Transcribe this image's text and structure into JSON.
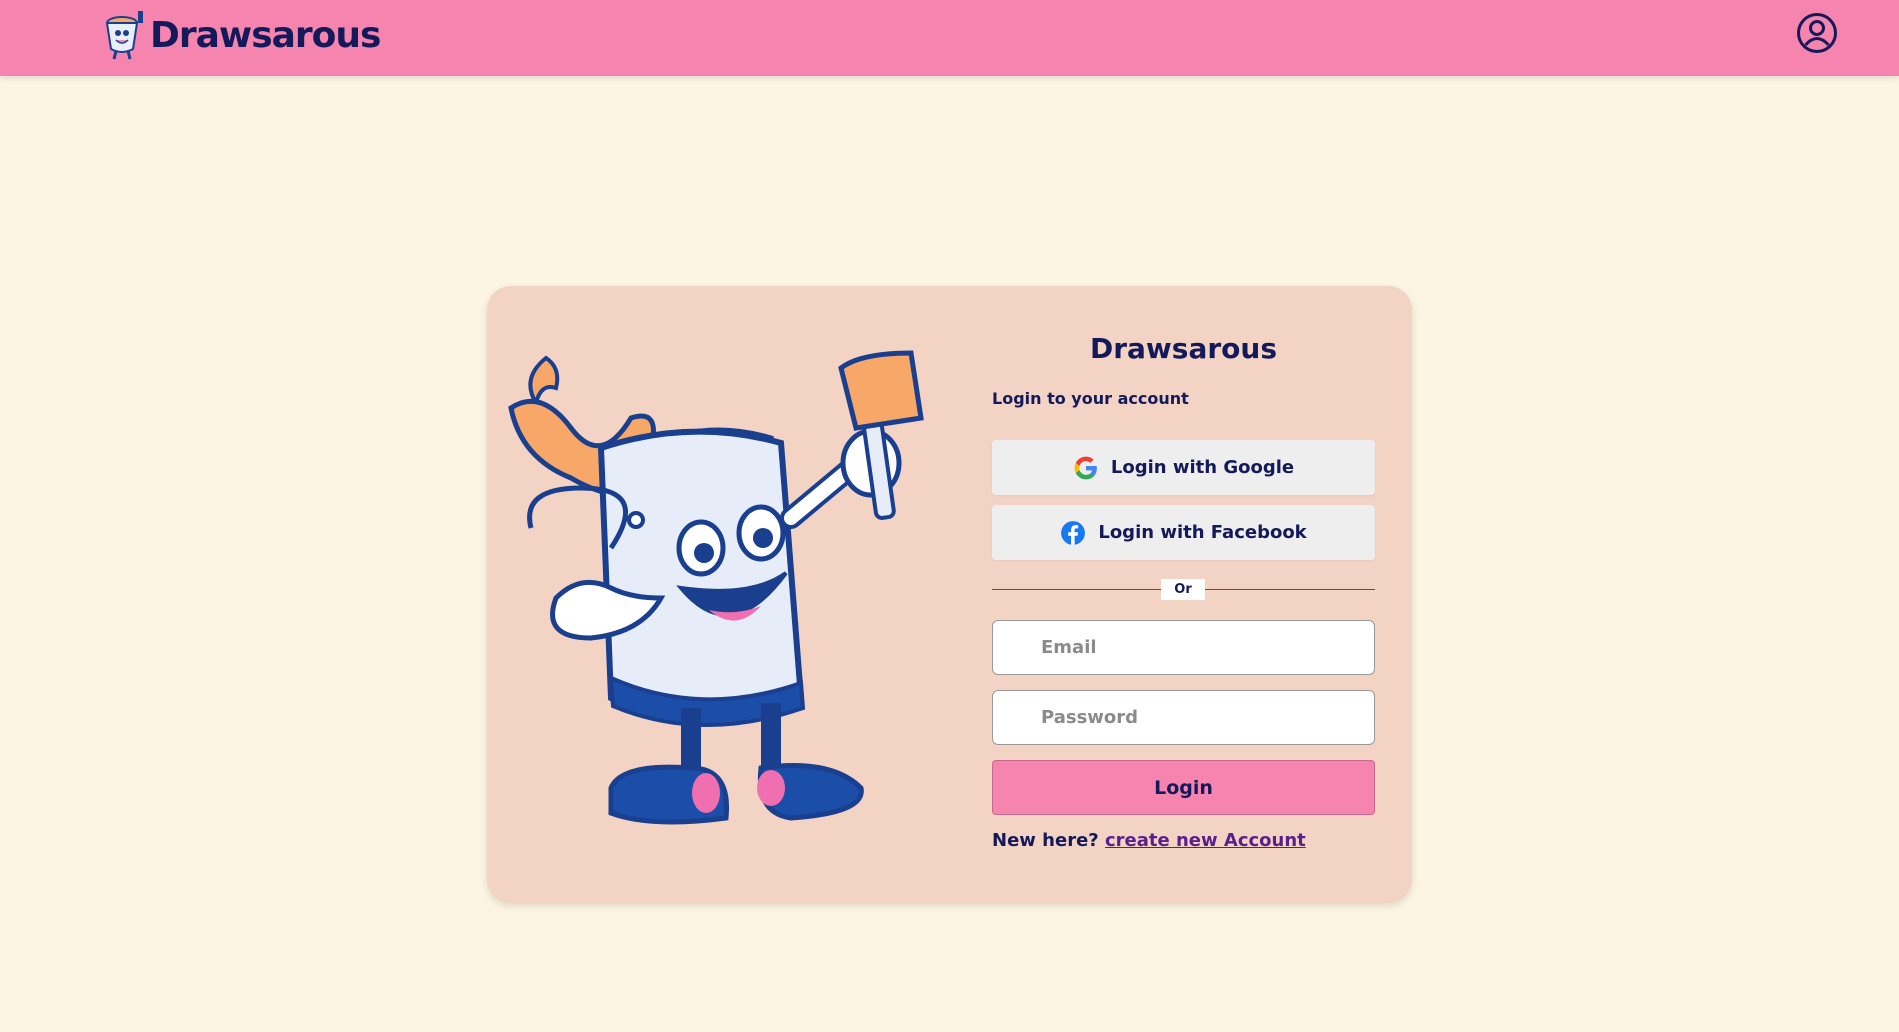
{
  "header": {
    "brand_name": "Drawsarous",
    "account_icon": "user-circle-icon"
  },
  "login": {
    "title": "Drawsarous",
    "subtitle": "Login to your account",
    "google_label": "Login with Google",
    "facebook_label": "Login with Facebook",
    "divider_label": "Or",
    "email_placeholder": "Email",
    "password_placeholder": "Password",
    "email_value": "",
    "password_value": "",
    "submit_label": "Login",
    "signup_prompt": "New here?",
    "signup_link": "create new Account"
  },
  "colors": {
    "header_bg": "#f584ae",
    "page_bg": "#fdf5e3",
    "card_bg": "#f2d3c4",
    "text": "#14195a",
    "link": "#5b1f8c"
  }
}
